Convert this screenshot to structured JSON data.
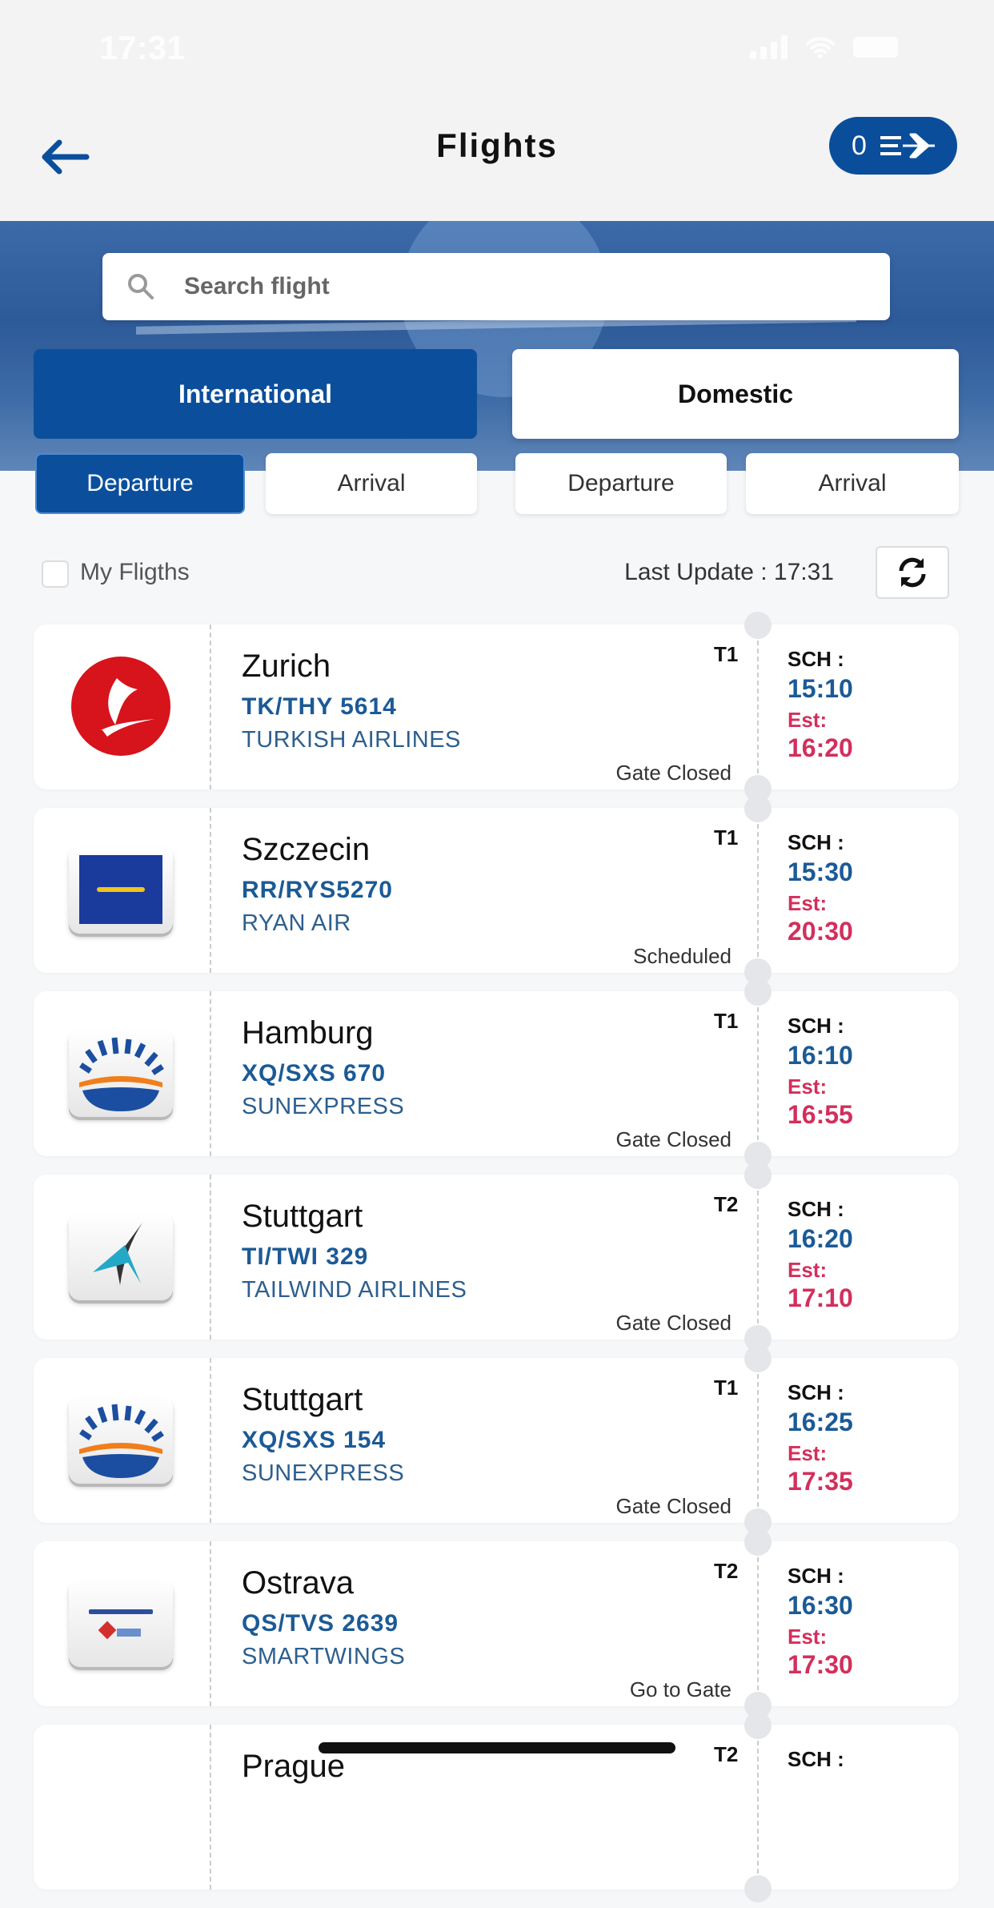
{
  "status_bar": {
    "time": "17:31"
  },
  "header": {
    "title": "Flights",
    "back_icon": "arrow-left-icon",
    "cart_count": "0",
    "cart_icon": "flight-list-icon"
  },
  "search": {
    "placeholder": "Search flight",
    "value": ""
  },
  "segments": [
    {
      "label": "International",
      "active": true
    },
    {
      "label": "Domestic",
      "active": false
    }
  ],
  "sub_tabs": [
    {
      "label": "Departure",
      "group": "International",
      "active": true
    },
    {
      "label": "Arrival",
      "group": "International",
      "active": false
    },
    {
      "label": "Departure",
      "group": "Domestic",
      "active": false
    },
    {
      "label": "Arrival",
      "group": "Domestic",
      "active": false
    }
  ],
  "filter": {
    "my_flights_label": "My Fligths",
    "my_flights_checked": false,
    "last_update": "Last Update : 17:31"
  },
  "labels": {
    "sch": "SCH :",
    "est": "Est:"
  },
  "colors": {
    "brand": "#0b4f9c",
    "sch_time": "#1b5a96",
    "est_time": "#d32f5c"
  },
  "flights": [
    {
      "city": "Zurich",
      "code": "TK/THY 5614",
      "airline": "TURKISH AIRLINES",
      "terminal": "T1",
      "status": "Gate Closed",
      "sch": "15:10",
      "est": "16:20",
      "logo": "turkish"
    },
    {
      "city": "Szczecin",
      "code": "RR/RYS5270",
      "airline": "RYAN AIR",
      "terminal": "T1",
      "status": "Scheduled",
      "sch": "15:30",
      "est": "20:30",
      "logo": "ryanair"
    },
    {
      "city": "Hamburg",
      "code": "XQ/SXS 670",
      "airline": "SUNEXPRESS",
      "terminal": "T1",
      "status": "Gate Closed",
      "sch": "16:10",
      "est": "16:55",
      "logo": "sunexpress"
    },
    {
      "city": "Stuttgart",
      "code": "TI/TWI 329",
      "airline": "TAILWIND AIRLINES",
      "terminal": "T2",
      "status": "Gate Closed",
      "sch": "16:20",
      "est": "17:10",
      "logo": "tailwind"
    },
    {
      "city": "Stuttgart",
      "code": "XQ/SXS 154",
      "airline": "SUNEXPRESS",
      "terminal": "T1",
      "status": "Gate Closed",
      "sch": "16:25",
      "est": "17:35",
      "logo": "sunexpress"
    },
    {
      "city": "Ostrava",
      "code": "QS/TVS 2639",
      "airline": "SMARTWINGS",
      "terminal": "T2",
      "status": "Go to Gate",
      "sch": "16:30",
      "est": "17:30",
      "logo": "smartwings"
    },
    {
      "city": "Prague",
      "code": "",
      "airline": "",
      "terminal": "T2",
      "status": "",
      "sch": "",
      "est": "",
      "logo": "none"
    }
  ]
}
